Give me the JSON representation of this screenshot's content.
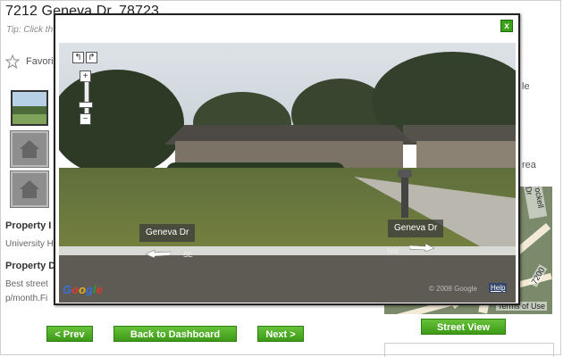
{
  "page": {
    "title": "7212 Geneva Dr, 78723",
    "tip": "Tip: Click th",
    "favorite_label": "Favori",
    "section1_heading": "Property I",
    "section1_text": "University H",
    "section2_heading": "Property D",
    "section2_text_line1": "Best street",
    "section2_text_line2": "p/month.Fi",
    "right_fragment1": "le",
    "right_fragment2": "rea"
  },
  "buttons": {
    "prev": "< Prev",
    "dashboard": "Back to Dashboard",
    "next": "Next >",
    "street_view": "Street View"
  },
  "street_view": {
    "close_label": "x",
    "zoom_in": "+",
    "zoom_out": "−",
    "zoom_level": 0.35,
    "street_label_left": "Geneva Dr",
    "street_label_right": "Geneva Dr",
    "compass_left": "SE",
    "compass_right": "NW",
    "copyright": "© 2008 Google",
    "help": "Help",
    "logo": "Google"
  },
  "map": {
    "label1": "rockell Dr",
    "label2": "7200",
    "label3": "Terms of Use"
  },
  "colors": {
    "accent_green": "#3d9a16"
  }
}
